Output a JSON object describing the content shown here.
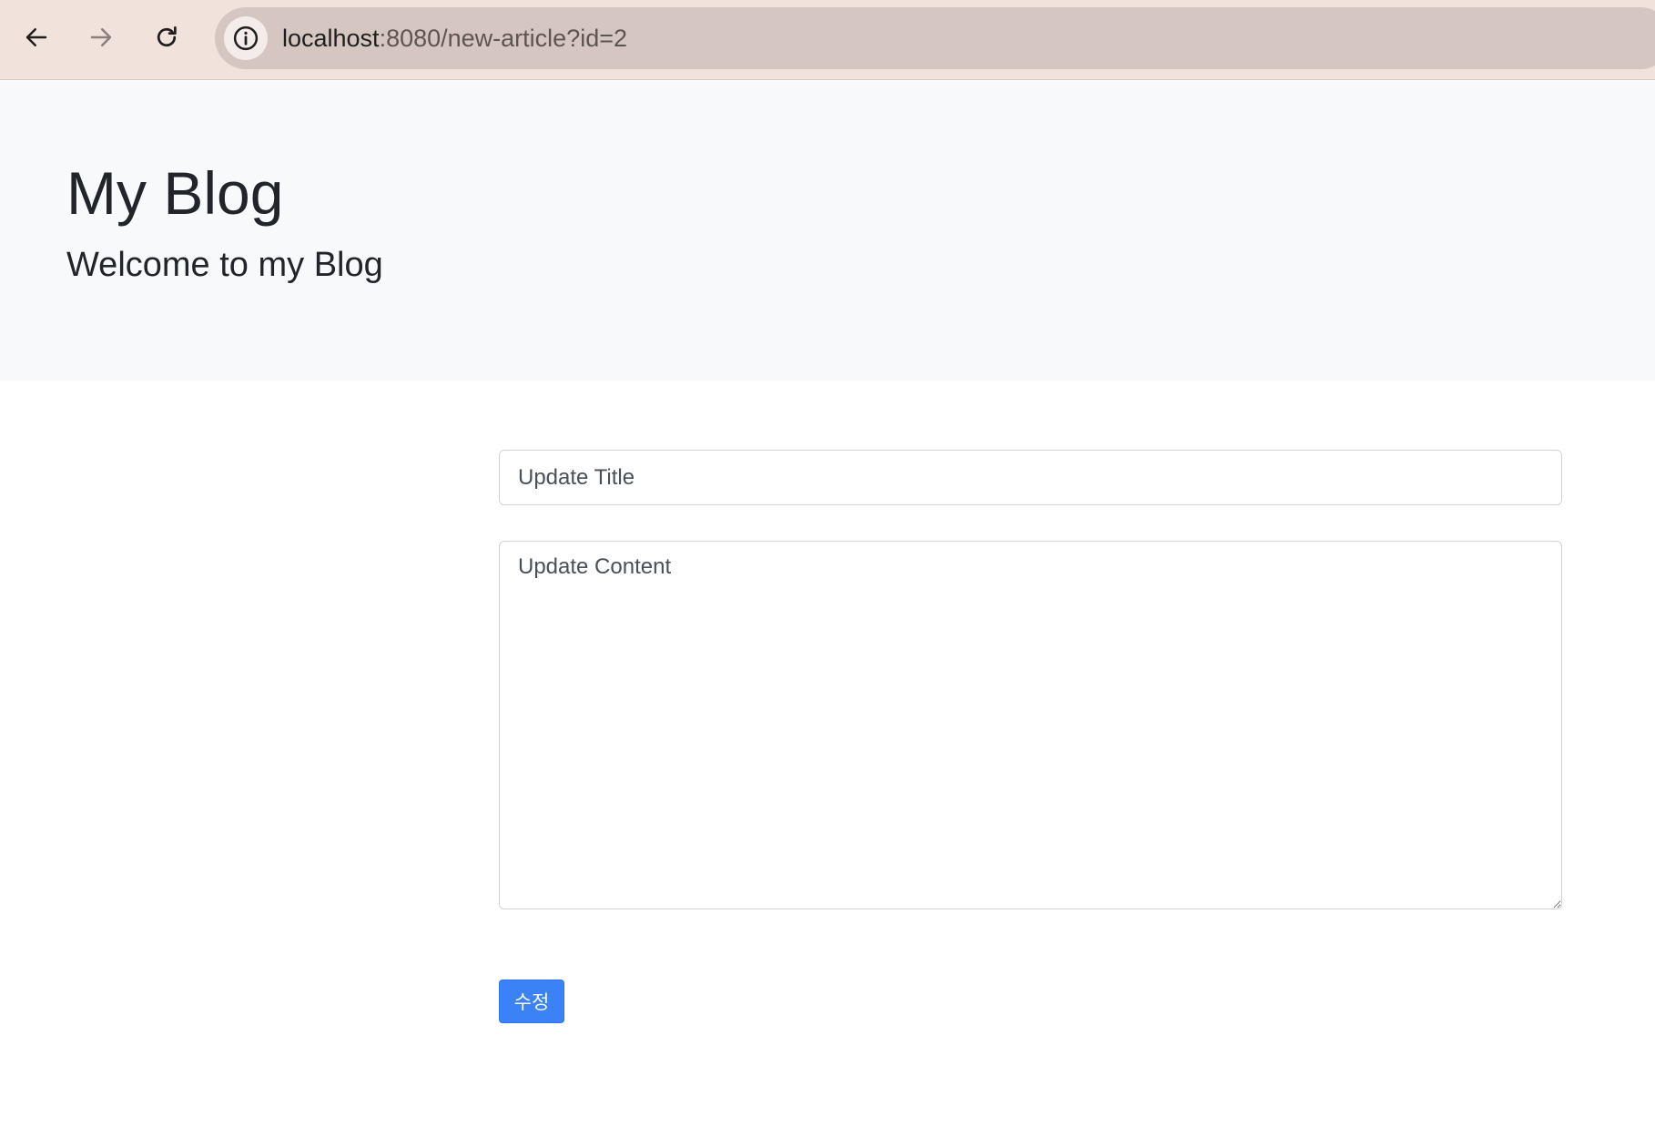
{
  "browser": {
    "url_host": "localhost",
    "url_rest": ":8080/new-article?id=2",
    "icons": {
      "back": "arrow-left-icon",
      "forward": "arrow-right-icon",
      "reload": "reload-icon",
      "site_info": "info-icon"
    }
  },
  "header": {
    "title": "My Blog",
    "subtitle": "Welcome to my Blog"
  },
  "form": {
    "title_placeholder": "Update Title",
    "content_placeholder": "Update Content",
    "submit_label": "수정"
  },
  "colors": {
    "browser_bar": "#f2e2dc",
    "address_bar": "#d6c6c1",
    "jumbotron": "#f8f9fa",
    "primary_button": "#3b82f6"
  }
}
